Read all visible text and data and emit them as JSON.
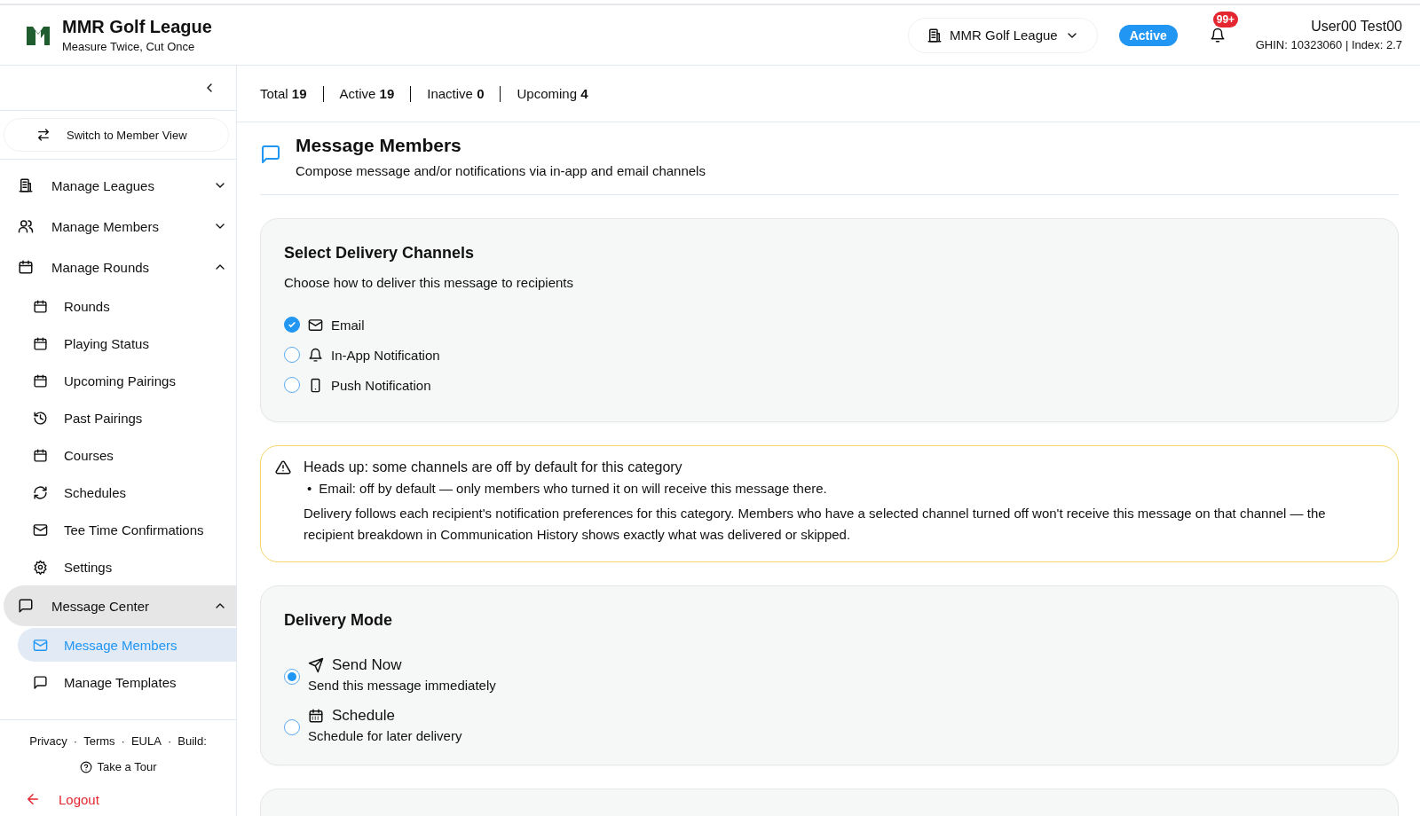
{
  "header": {
    "title": "MMR Golf League",
    "tagline": "Measure Twice, Cut Once",
    "league_selector": "MMR Golf League",
    "status_badge": "Active",
    "notification_count": "99+",
    "user_name": "User00 Test00",
    "user_meta": "GHIN: 10323060 | Index: 2.7"
  },
  "sidebar": {
    "switch_button": "Switch to Member View",
    "items": [
      {
        "label": "Manage Leagues",
        "expanded": false,
        "selected": false
      },
      {
        "label": "Manage Members",
        "expanded": false,
        "selected": false
      },
      {
        "label": "Manage Rounds",
        "expanded": true,
        "selected": false,
        "children": [
          {
            "label": "Rounds",
            "selected": false
          },
          {
            "label": "Playing Status",
            "selected": false
          },
          {
            "label": "Upcoming Pairings",
            "selected": false
          },
          {
            "label": "Past Pairings",
            "selected": false
          },
          {
            "label": "Courses",
            "selected": false
          },
          {
            "label": "Schedules",
            "selected": false
          },
          {
            "label": "Tee Time Confirmations",
            "selected": false
          },
          {
            "label": "Settings",
            "selected": false
          }
        ]
      },
      {
        "label": "Message Center",
        "expanded": true,
        "selected": true,
        "children": [
          {
            "label": "Message Members",
            "selected": true
          },
          {
            "label": "Manage Templates",
            "selected": false
          }
        ]
      }
    ],
    "footer_links": [
      "Privacy",
      "Terms",
      "EULA",
      "Build:"
    ],
    "footer_separator": "·",
    "tour": "Take a Tour",
    "logout": "Logout"
  },
  "stats": [
    {
      "label": "Total",
      "value": "19"
    },
    {
      "label": "Active",
      "value": "19"
    },
    {
      "label": "Inactive",
      "value": "0"
    },
    {
      "label": "Upcoming",
      "value": "4"
    }
  ],
  "page": {
    "title": "Message Members",
    "subtitle": "Compose message and/or notifications via in-app and email channels"
  },
  "channels_card": {
    "title": "Select Delivery Channels",
    "subtitle": "Choose how to deliver this message to recipients",
    "channels": [
      {
        "label": "Email",
        "checked": true
      },
      {
        "label": "In-App Notification",
        "checked": false
      },
      {
        "label": "Push Notification",
        "checked": false
      }
    ]
  },
  "warning": {
    "bullet": "•",
    "title": "Heads up: some channels are off by default for this category",
    "bullets": [
      "Email: off by default — only members who turned it on will receive this message there."
    ],
    "body": "Delivery follows each recipient's notification preferences for this category. Members who have a selected channel turned off won't receive this message on that channel — the recipient breakdown in Communication History shows exactly what was delivered or skipped."
  },
  "mode_card": {
    "title": "Delivery Mode",
    "modes": [
      {
        "label": "Send Now",
        "description": "Send this message immediately",
        "selected": true
      },
      {
        "label": "Schedule",
        "description": "Schedule for later delivery",
        "selected": false
      }
    ]
  }
}
